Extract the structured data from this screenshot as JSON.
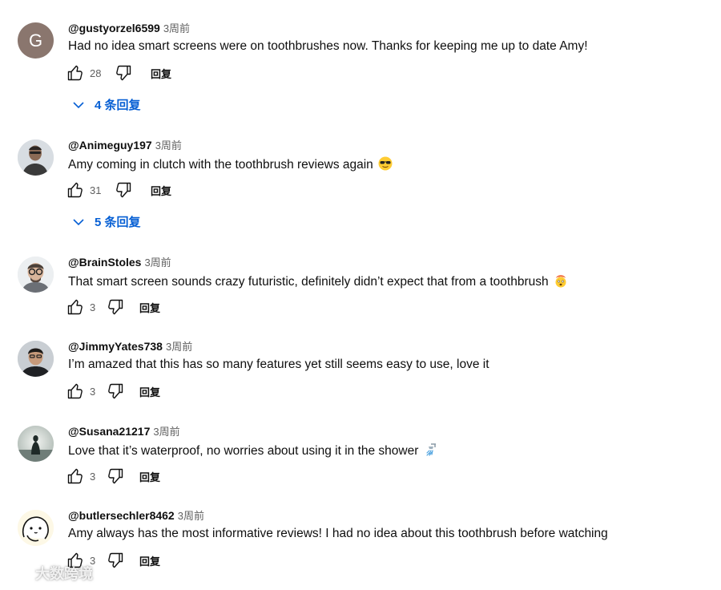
{
  "comments": [
    {
      "author": "@gustyorzel6599",
      "time": "3周前",
      "text": "Had no idea smart screens were on toothbrushes now. Thanks for keeping me up to date Amy!",
      "likes": "28",
      "avatar_letter": "G",
      "replies_label": "4 条回复"
    },
    {
      "author": "@Animeguy197",
      "time": "3周前",
      "text": "Amy coming in clutch with the toothbrush reviews again",
      "emoji": "sunglasses-emoji",
      "likes": "31",
      "replies_label": "5 条回复"
    },
    {
      "author": "@BrainStoles",
      "time": "3周前",
      "text": "That smart screen sounds crazy futuristic, definitely didn’t expect that from a toothbrush",
      "emoji": "exploding-head-emoji",
      "likes": "3"
    },
    {
      "author": "@JimmyYates738",
      "time": "3周前",
      "text": "I’m amazed that this has so many features yet still seems easy to use, love it",
      "likes": "3"
    },
    {
      "author": "@Susana21217",
      "time": "3周前",
      "text": "Love that it’s waterproof, no worries about using it in the shower",
      "emoji": "shower-emoji",
      "likes": "3"
    },
    {
      "author": "@butlersechler8462",
      "time": "3周前",
      "text": "Amy always has the most informative reviews! I had no idea about this toothbrush before watching",
      "likes": "3"
    }
  ],
  "reply_label": "回复",
  "watermark": "大数跨境",
  "colors": {
    "link": "#065fd4",
    "secondary": "#606060",
    "avatar_g": "#8a766e"
  }
}
